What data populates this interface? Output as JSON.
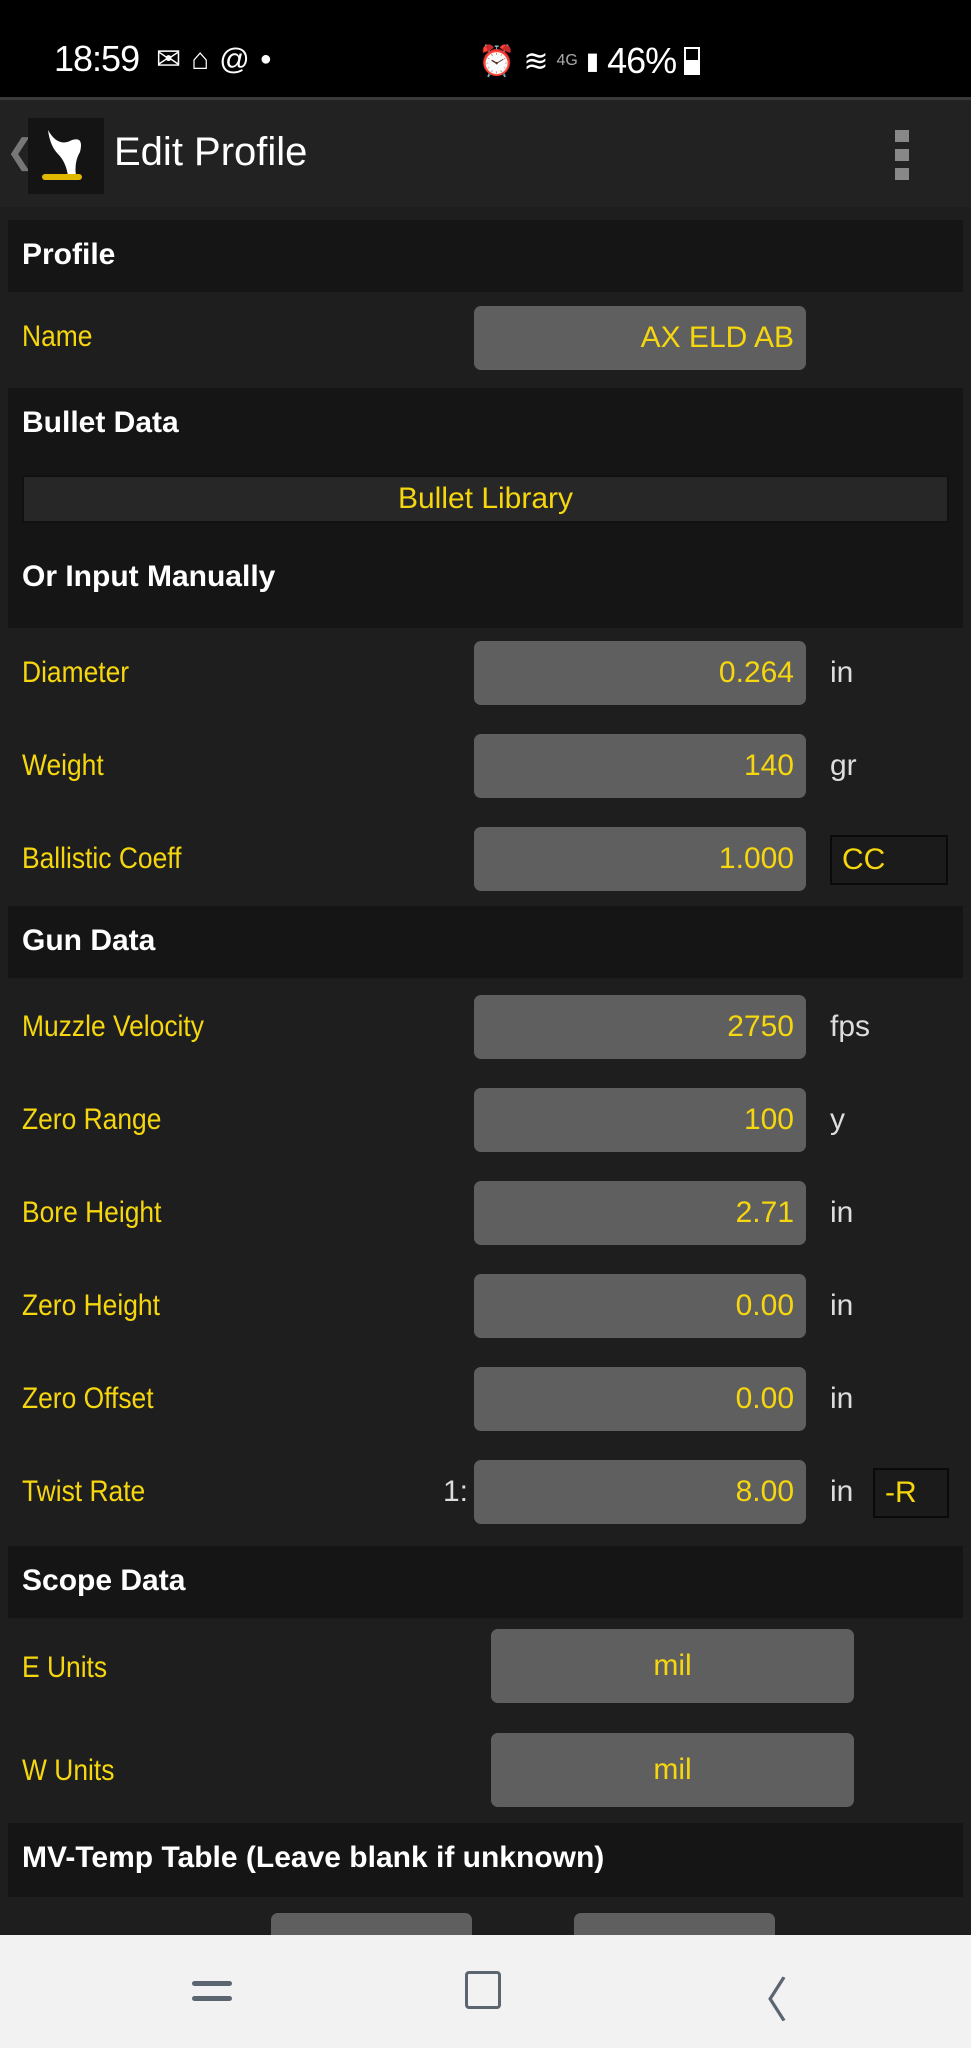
{
  "status_bar": {
    "time": "18:59",
    "left_icons": [
      "mail-icon",
      "home-icon",
      "at-icon",
      "dot-icon"
    ],
    "right_icons": [
      "alarm-icon",
      "wifi-icon",
      "4g-icon",
      "signal-icon"
    ],
    "battery_percent": "46%",
    "battery_level": 0.46
  },
  "app_bar": {
    "back_glyph": "❮",
    "title": "Edit Profile"
  },
  "sections": {
    "profile": {
      "title": "Profile",
      "name_label": "Name",
      "name_value": "AX ELD AB"
    },
    "bullet_data": {
      "title": "Bullet Data",
      "library_button": "Bullet Library",
      "manual_title": "Or Input Manually",
      "diameter": {
        "label": "Diameter",
        "value": "0.264",
        "unit": "in"
      },
      "weight": {
        "label": "Weight",
        "value": "140",
        "unit": "gr"
      },
      "bc": {
        "label": "Ballistic Coeff",
        "value": "1.000",
        "model": "CC"
      }
    },
    "gun_data": {
      "title": "Gun Data",
      "muzzle_velocity": {
        "label": "Muzzle Velocity",
        "value": "2750",
        "unit": "fps"
      },
      "zero_range": {
        "label": "Zero Range",
        "value": "100",
        "unit": "y"
      },
      "bore_height": {
        "label": "Bore Height",
        "value": "2.71",
        "unit": "in"
      },
      "zero_height": {
        "label": "Zero Height",
        "value": "0.00",
        "unit": "in"
      },
      "zero_offset": {
        "label": "Zero Offset",
        "value": "0.00",
        "unit": "in"
      },
      "twist_rate": {
        "label": "Twist Rate",
        "prefix": "1:",
        "value": "8.00",
        "unit": "in",
        "direction": "-R"
      }
    },
    "scope_data": {
      "title": "Scope Data",
      "e_units": {
        "label": "E Units",
        "value": "mil"
      },
      "w_units": {
        "label": "W Units",
        "value": "mil"
      }
    },
    "mv_temp": {
      "title": "MV-Temp Table (Leave blank if unknown)"
    }
  },
  "colors": {
    "accent": "#f5d60f",
    "field_bg": "#5f5f5f",
    "section_bg": "#151515",
    "page_bg": "#1e1e1e"
  }
}
